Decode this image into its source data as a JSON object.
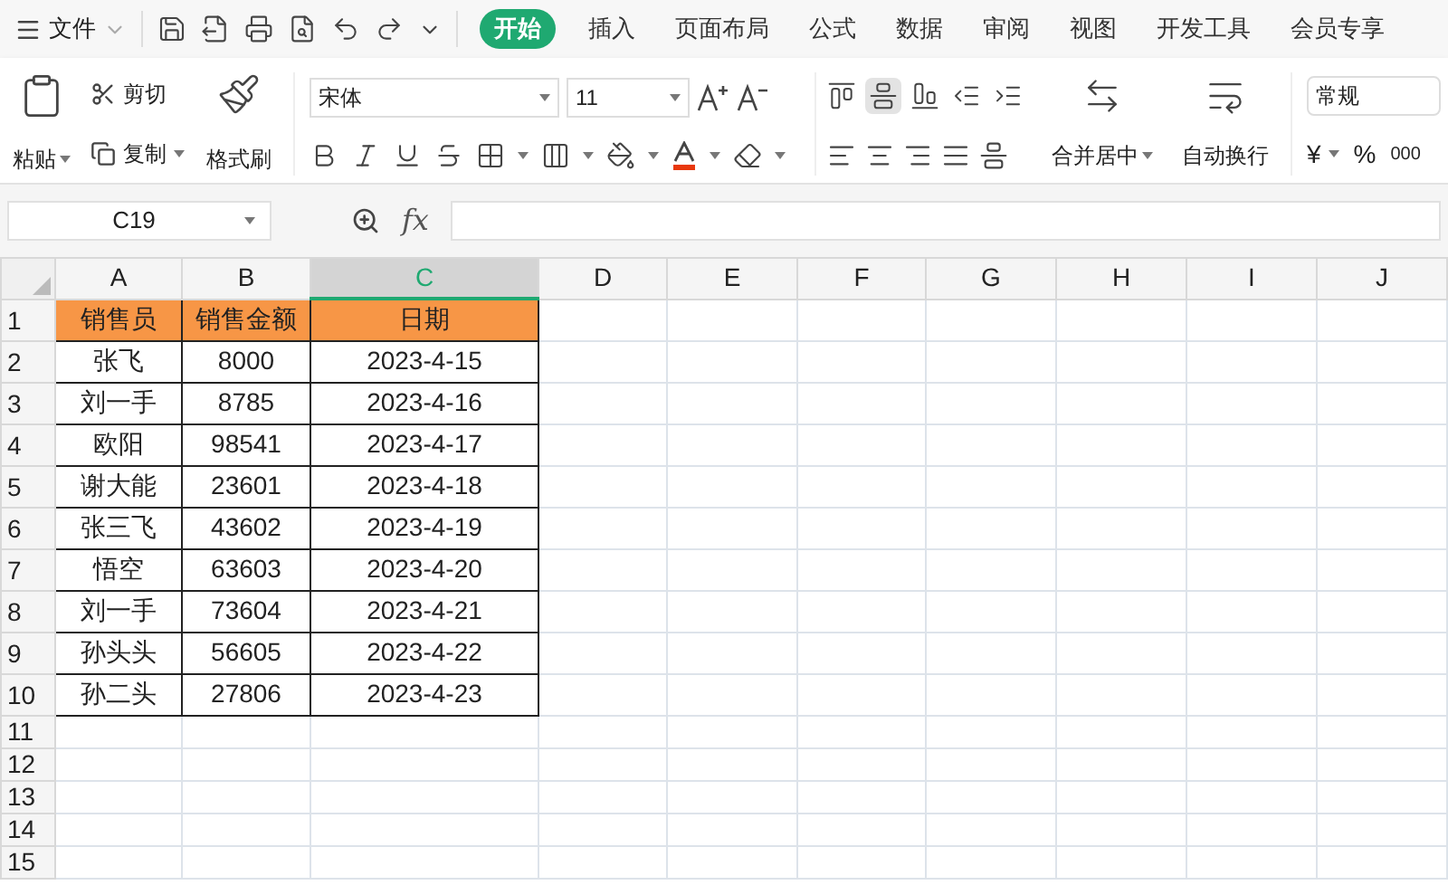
{
  "menu": {
    "label": "文件"
  },
  "tabs": [
    {
      "label": "开始",
      "selected": true
    },
    {
      "label": "插入",
      "selected": false
    },
    {
      "label": "页面布局",
      "selected": false
    },
    {
      "label": "公式",
      "selected": false
    },
    {
      "label": "数据",
      "selected": false
    },
    {
      "label": "审阅",
      "selected": false
    },
    {
      "label": "视图",
      "selected": false
    },
    {
      "label": "开发工具",
      "selected": false
    },
    {
      "label": "会员专享",
      "selected": false
    }
  ],
  "ribbon": {
    "paste": "粘贴",
    "cut": "剪切",
    "copy": "复制",
    "format_painter": "格式刷",
    "font": "宋体",
    "font_size": "11",
    "align_buttons": [
      {
        "kind": "top",
        "selected": false
      },
      {
        "kind": "middle",
        "selected": true
      },
      {
        "kind": "bottom",
        "selected": false
      },
      {
        "kind": "outdent",
        "selected": false
      },
      {
        "kind": "indent",
        "selected": false
      }
    ],
    "merge": "合并居中",
    "wrap": "自动换行",
    "number_format": "常规",
    "currency": "¥",
    "percent": "%",
    "thousands": "000"
  },
  "formula_bar": {
    "name_box": "C19",
    "fx": "fx"
  },
  "sheet": {
    "columns": [
      {
        "label": "A",
        "selected": false
      },
      {
        "label": "B",
        "selected": false
      },
      {
        "label": "C",
        "selected": true
      },
      {
        "label": "D",
        "selected": false
      },
      {
        "label": "E",
        "selected": false
      },
      {
        "label": "F",
        "selected": false
      },
      {
        "label": "G",
        "selected": false
      },
      {
        "label": "H",
        "selected": false
      },
      {
        "label": "I",
        "selected": false
      },
      {
        "label": "J",
        "selected": false
      }
    ],
    "rows": [
      {
        "number": "1",
        "kind": "header",
        "cells": [
          "销售员",
          "销售金额",
          "日期"
        ]
      },
      {
        "number": "2",
        "kind": "data",
        "cells": [
          "张飞",
          "8000",
          "2023-4-15"
        ]
      },
      {
        "number": "3",
        "kind": "data",
        "cells": [
          "刘一手",
          "8785",
          "2023-4-16"
        ]
      },
      {
        "number": "4",
        "kind": "data",
        "cells": [
          "欧阳",
          "98541",
          "2023-4-17"
        ]
      },
      {
        "number": "5",
        "kind": "data",
        "cells": [
          "谢大能",
          "23601",
          "2023-4-18"
        ]
      },
      {
        "number": "6",
        "kind": "data",
        "cells": [
          "张三飞",
          "43602",
          "2023-4-19"
        ]
      },
      {
        "number": "7",
        "kind": "data",
        "cells": [
          "悟空",
          "63603",
          "2023-4-20"
        ]
      },
      {
        "number": "8",
        "kind": "data",
        "cells": [
          "刘一手",
          "73604",
          "2023-4-21"
        ]
      },
      {
        "number": "9",
        "kind": "data",
        "cells": [
          "孙头头",
          "56605",
          "2023-4-22"
        ]
      },
      {
        "number": "10",
        "kind": "data",
        "cells": [
          "孙二头",
          "27806",
          "2023-4-23"
        ]
      },
      {
        "number": "11",
        "kind": "empty"
      },
      {
        "number": "12",
        "kind": "empty"
      },
      {
        "number": "13",
        "kind": "empty"
      },
      {
        "number": "14",
        "kind": "empty"
      },
      {
        "number": "15",
        "kind": "empty"
      }
    ]
  }
}
